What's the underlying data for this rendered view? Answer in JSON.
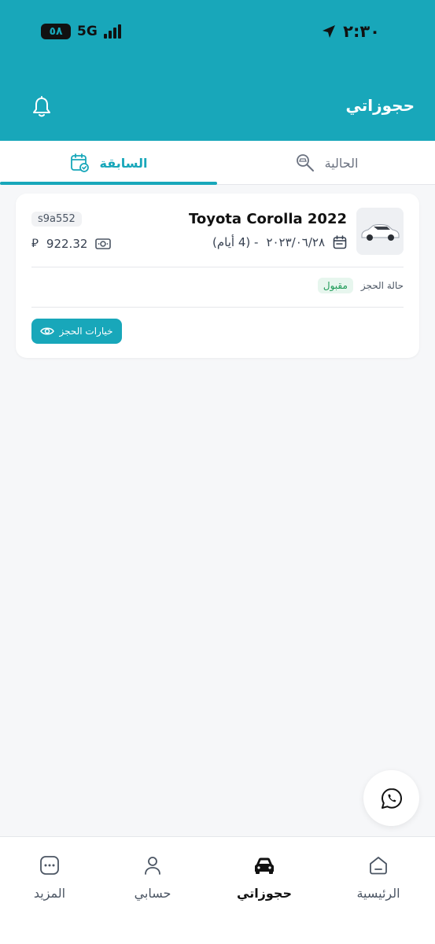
{
  "status_bar": {
    "time": "٢:٣٠",
    "battery": "٥٨",
    "network": "5G"
  },
  "header": {
    "title": "حجوزاتي"
  },
  "tabs": [
    {
      "label": "الحالية",
      "icon": "search-car-icon",
      "active": false
    },
    {
      "label": "السابقة",
      "icon": "calendar-check-icon",
      "active": true
    }
  ],
  "booking": {
    "car_name": "Toyota Corolla 2022",
    "car_image": "white-sedan",
    "date": "٢٠٢٣/٠٦/٢٨",
    "duration": "- (4 أيام)",
    "code": "s9a552",
    "price": "922.32",
    "currency_symbol": "⃁",
    "status_label": "حالة الحجز",
    "status": "مقبول",
    "options_button": "خيارات الحجز"
  },
  "bottom_nav": [
    {
      "label": "الرئيسية",
      "icon": "home-icon",
      "active": false
    },
    {
      "label": "حجوزاتي",
      "icon": "car-icon",
      "active": true
    },
    {
      "label": "حسابي",
      "icon": "user-icon",
      "active": false
    },
    {
      "label": "المزيد",
      "icon": "more-icon",
      "active": false
    }
  ],
  "colors": {
    "primary": "#18a7ba",
    "status_accepted_bg": "#e7f6ee",
    "status_accepted_text": "#1c9a56",
    "background": "#f6f7f9"
  }
}
